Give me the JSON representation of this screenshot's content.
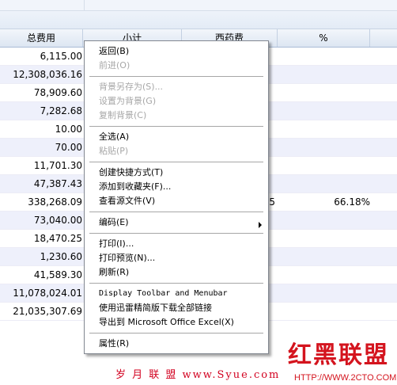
{
  "columns": {
    "total": "总费用",
    "subtotal": "小计",
    "drug": "西药费",
    "pct": "%"
  },
  "rows": [
    {
      "total": "6,115.00",
      "drug": "",
      "pct": ""
    },
    {
      "total": "12,308,036.16",
      "drug": "",
      "pct": ""
    },
    {
      "total": "78,909.60",
      "drug": "",
      "pct": ""
    },
    {
      "total": "7,282.68",
      "drug": "",
      "pct": ""
    },
    {
      "total": "10.00",
      "drug": "",
      "pct": ""
    },
    {
      "total": "70.00",
      "drug": "",
      "pct": ""
    },
    {
      "total": "11,701.30",
      "drug": "",
      "pct": ""
    },
    {
      "total": "47,387.43",
      "drug": "",
      "pct": ""
    },
    {
      "total": "338,268.09",
      "drug": "5",
      "pct": "66.18%"
    },
    {
      "total": "73,040.00",
      "drug": "",
      "pct": ""
    },
    {
      "total": "18,470.25",
      "drug": "",
      "pct": ""
    },
    {
      "total": "1,230.60",
      "drug": "",
      "pct": ""
    },
    {
      "total": "41,589.30",
      "drug": "",
      "pct": ""
    },
    {
      "total": "11,078,024.01",
      "drug": "",
      "pct": ""
    },
    {
      "total": "21,035,307.69",
      "drug": "",
      "pct": ""
    }
  ],
  "context_menu": {
    "back": "返回(B)",
    "forward": "前进(O)",
    "save_background": "背景另存为(S)...",
    "set_background": "设置为背景(G)",
    "copy_background": "复制背景(C)",
    "select_all": "全选(A)",
    "paste": "粘贴(P)",
    "create_shortcut": "创建快捷方式(T)",
    "add_favorites": "添加到收藏夹(F)...",
    "view_source": "查看源文件(V)",
    "encoding": "编码(E)",
    "print": "打印(I)...",
    "print_preview": "打印预览(N)...",
    "refresh": "刷新(R)",
    "display_toolbar": "Display Toolbar and Menubar",
    "download_all": "使用迅雷精简版下载全部链接",
    "export_excel": "导出到 Microsoft Office Excel(X)",
    "properties": "属性(R)"
  },
  "watermarks": {
    "left": "岁 月 联 盟   www.Syue.com",
    "brand": "红黑联盟",
    "url": "HTTP://WWW.2CTO.COM"
  }
}
